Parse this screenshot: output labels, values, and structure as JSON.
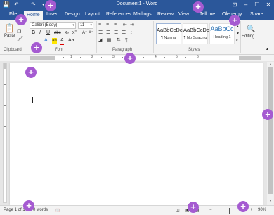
{
  "titlebar": {
    "title": "Document1 - Word",
    "save_icon": "save-icon",
    "undo_icon": "undo-icon",
    "redo_icon": "redo-icon",
    "controls": {
      "ribbon_options": "⊡",
      "minimize": "–",
      "maximize": "☐",
      "close": "✕"
    }
  },
  "tabs": [
    {
      "label": "File"
    },
    {
      "label": "Home"
    },
    {
      "label": "Insert"
    },
    {
      "label": "Design"
    },
    {
      "label": "Layout"
    },
    {
      "label": "References"
    },
    {
      "label": "Mailings"
    },
    {
      "label": "Review"
    },
    {
      "label": "View"
    },
    {
      "label": "Tell me..."
    },
    {
      "label": "Olenergy"
    },
    {
      "label": "Share"
    }
  ],
  "ribbon": {
    "clipboard": {
      "label": "Clipboard",
      "paste": "Paste"
    },
    "font": {
      "label": "Font",
      "font_name": "Calibri (Body)",
      "font_size": "11",
      "bold": "B",
      "italic": "I",
      "underline": "U",
      "strike": "abc",
      "sub": "x₂",
      "sup": "x²",
      "text_effects": "A",
      "highlight": "ab",
      "font_color": "A",
      "change_case": "Aa",
      "grow": "A⁺",
      "shrink": "A⁻"
    },
    "paragraph": {
      "label": "Paragraph"
    },
    "styles": {
      "label": "Styles",
      "items": [
        {
          "sample": "AaBbCcDc",
          "name": "¶ Normal"
        },
        {
          "sample": "AaBbCcDc",
          "name": "¶ No Spacing"
        },
        {
          "sample": "AaBbCc",
          "name": "Heading 1"
        }
      ]
    },
    "editing": {
      "label": "Editing"
    }
  },
  "ruler": {
    "numbers": [
      "1",
      "2",
      "3",
      "4",
      "5",
      "6"
    ]
  },
  "status": {
    "page": "Page 1 of 1",
    "words": "0 words",
    "zoom": "90%"
  },
  "markers": [
    "+",
    "+",
    "+",
    "+",
    "+",
    "+",
    "+",
    "+",
    "+",
    "+",
    "+",
    "+"
  ],
  "colors": {
    "accent": "#2b579a",
    "marker": "#a55bd1"
  }
}
